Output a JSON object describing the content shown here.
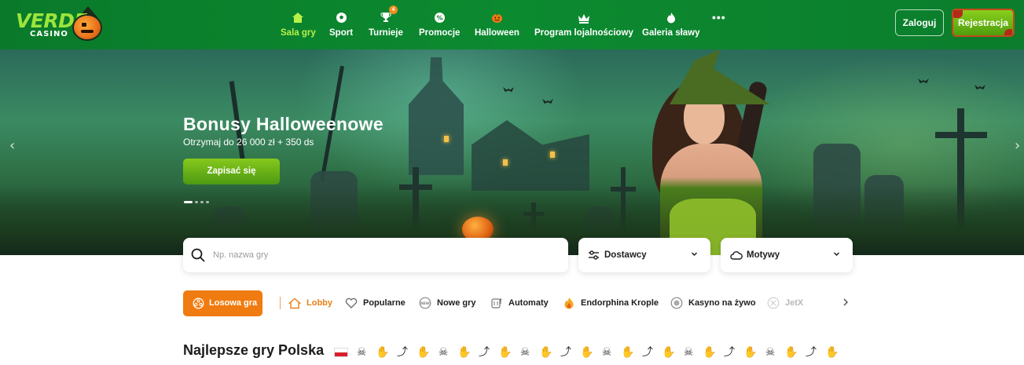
{
  "logo": {
    "brand": "VERDE",
    "sub": "CASINO"
  },
  "nav": [
    {
      "label": "Sala gry",
      "icon": "home-icon",
      "active": true
    },
    {
      "label": "Sport",
      "icon": "soccer-ball-icon"
    },
    {
      "label": "Turnieje",
      "icon": "trophy-icon",
      "badge": "4"
    },
    {
      "label": "Promocje",
      "icon": "percent-badge-icon"
    },
    {
      "label": "Halloween",
      "icon": "pumpkin-icon"
    },
    {
      "label": "Program lojalnościowy",
      "icon": "crown-icon"
    },
    {
      "label": "Galeria sławy",
      "icon": "flame-icon"
    },
    {
      "label": "•••",
      "icon": "more-icon"
    }
  ],
  "auth": {
    "login_label": "Zaloguj",
    "register_label": "Rejestracja"
  },
  "hero": {
    "title": "Bonusy Halloweenowe",
    "subtitle": "Otrzymaj do 26 000 zł + 350 ds",
    "cta_label": "Zapisać się",
    "slide_count": 4,
    "active_slide": 1,
    "prev_arrow": "‹",
    "next_arrow": "›"
  },
  "search": {
    "placeholder": "Np. nazwa gry"
  },
  "filters": {
    "providers_label": "Dostawcy",
    "themes_label": "Motywy"
  },
  "categories": {
    "random_label": "Losowa gra",
    "items": [
      {
        "label": "Lobby",
        "icon": "home-outline-icon",
        "active": true
      },
      {
        "label": "Popularne",
        "icon": "heart-icon"
      },
      {
        "label": "Nowe gry",
        "icon": "new-badge-icon"
      },
      {
        "label": "Automaty",
        "icon": "slot-machine-icon"
      },
      {
        "label": "Endorphina Krople",
        "icon": "drop-flame-icon"
      },
      {
        "label": "Kasyno na żywo",
        "icon": "live-chip-icon"
      },
      {
        "label": "JetX",
        "icon": "jetx-icon",
        "disabled": true
      }
    ]
  },
  "section": {
    "title": "Najlepsze gry Polska"
  },
  "colors": {
    "header_green": "#0c8a30",
    "accent_lime": "#b8f04a",
    "orange": "#f07b10",
    "cta_green": "#6bb318"
  }
}
